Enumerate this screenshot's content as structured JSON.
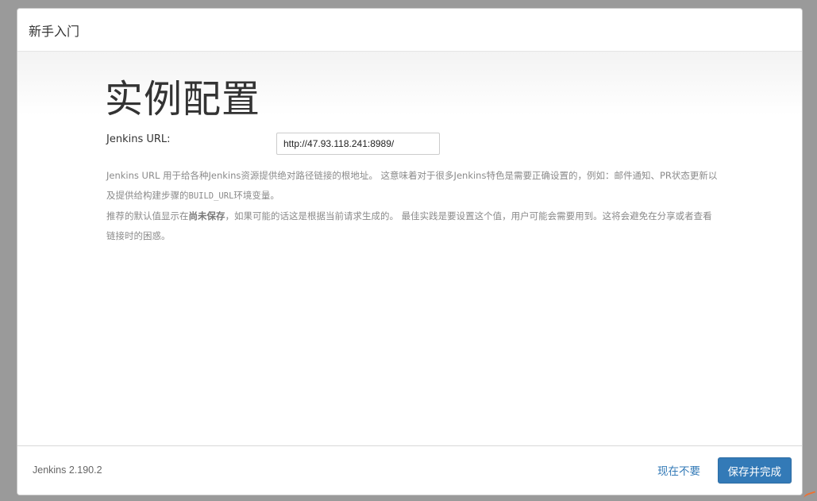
{
  "header": {
    "title": "新手入门"
  },
  "main": {
    "page_title": "实例配置",
    "url_label": "Jenkins URL:",
    "url_value": "http://47.93.118.241:8989/",
    "help": {
      "p1_a": "Jenkins URL 用于给各种Jenkins资源提供绝对路径链接的根地址。 这意味着对于很多Jenkins特色是需要正确设置的，例如：邮件通知、PR状态更新以及提供给构建步骤的",
      "p1_code": "BUILD_URL",
      "p1_b": "环境变量。",
      "p2_a": "推荐的默认值显示在",
      "p2_strong": "尚未保存",
      "p2_b": "，如果可能的话这是根据当前请求生成的。 最佳实践是要设置这个值，用户可能会需要用到。这将会避免在分享或者查看链接时的困惑。"
    }
  },
  "footer": {
    "version": "Jenkins 2.190.2",
    "skip_label": "现在不要",
    "save_label": "保存并完成"
  },
  "colors": {
    "accent": "#337ab7",
    "backdrop": "#9a9a9a"
  }
}
